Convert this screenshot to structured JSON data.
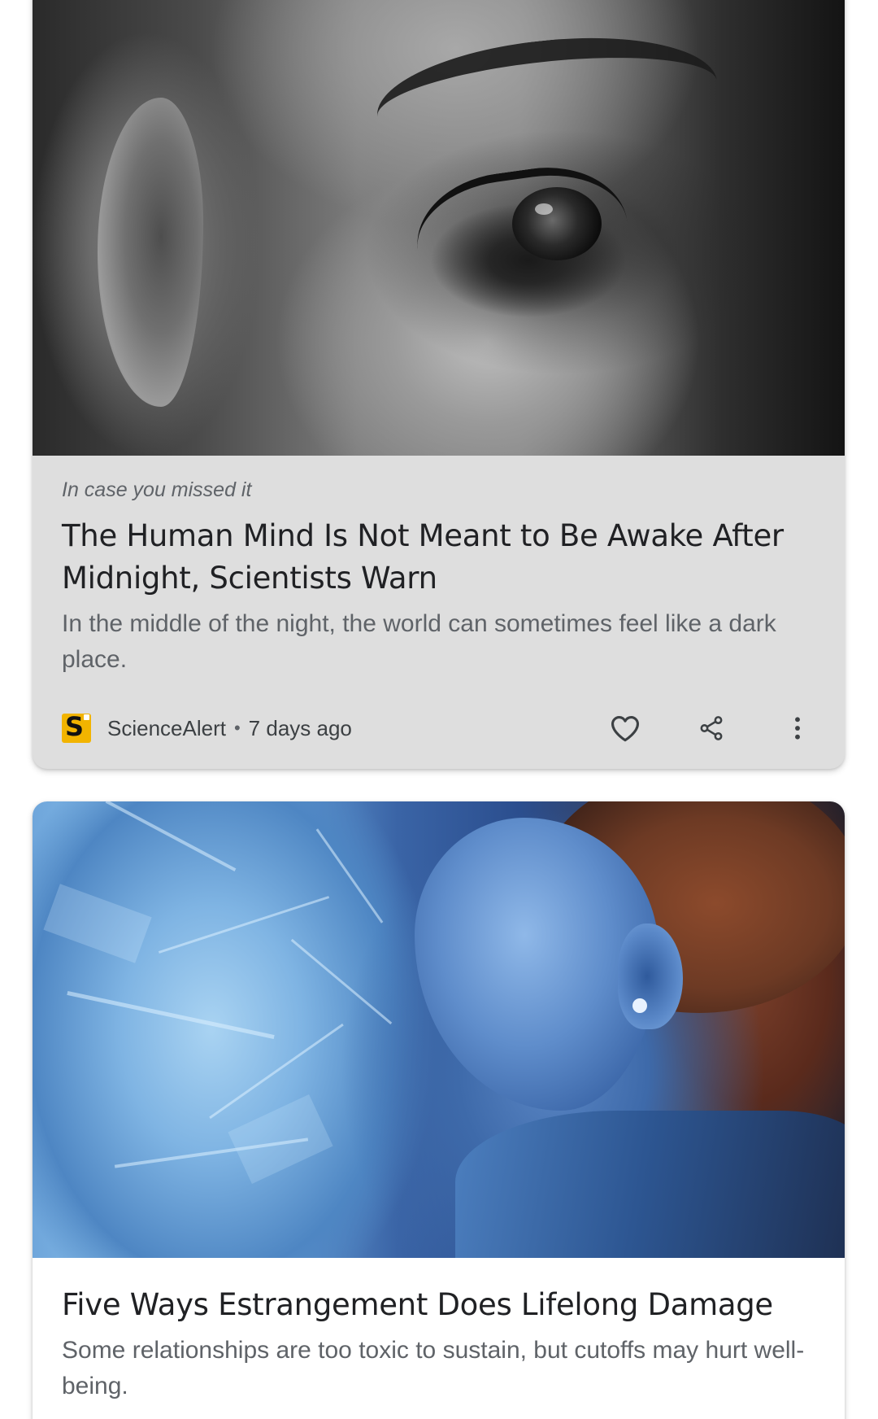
{
  "feed": {
    "cards": [
      {
        "kicker": "In case you missed it",
        "title": "The Human Mind Is Not Meant to Be Awake After Midnight, Scientists Warn",
        "snippet": "In the middle of the night, the world can sometimes feel like a dark place.",
        "source": "ScienceAlert",
        "age": "7 days ago",
        "source_logo_letter": "S",
        "source_logo_color": "#f2b400",
        "image": "black-and-white-eye-photo",
        "actions": [
          "heart-icon",
          "share-icon",
          "more-vert-icon"
        ]
      },
      {
        "title": "Five Ways Estrangement Does Lifelong Damage",
        "snippet": "Some relationships are too toxic to sustain, but cutoffs may hurt well-being.",
        "image": "blue-toned-man-shattering-glass-photo"
      }
    ],
    "colors": {
      "card_highlight_bg": "#dedede",
      "card_bg": "#ffffff",
      "title_text": "#202124",
      "secondary_text": "#5f6368"
    }
  }
}
